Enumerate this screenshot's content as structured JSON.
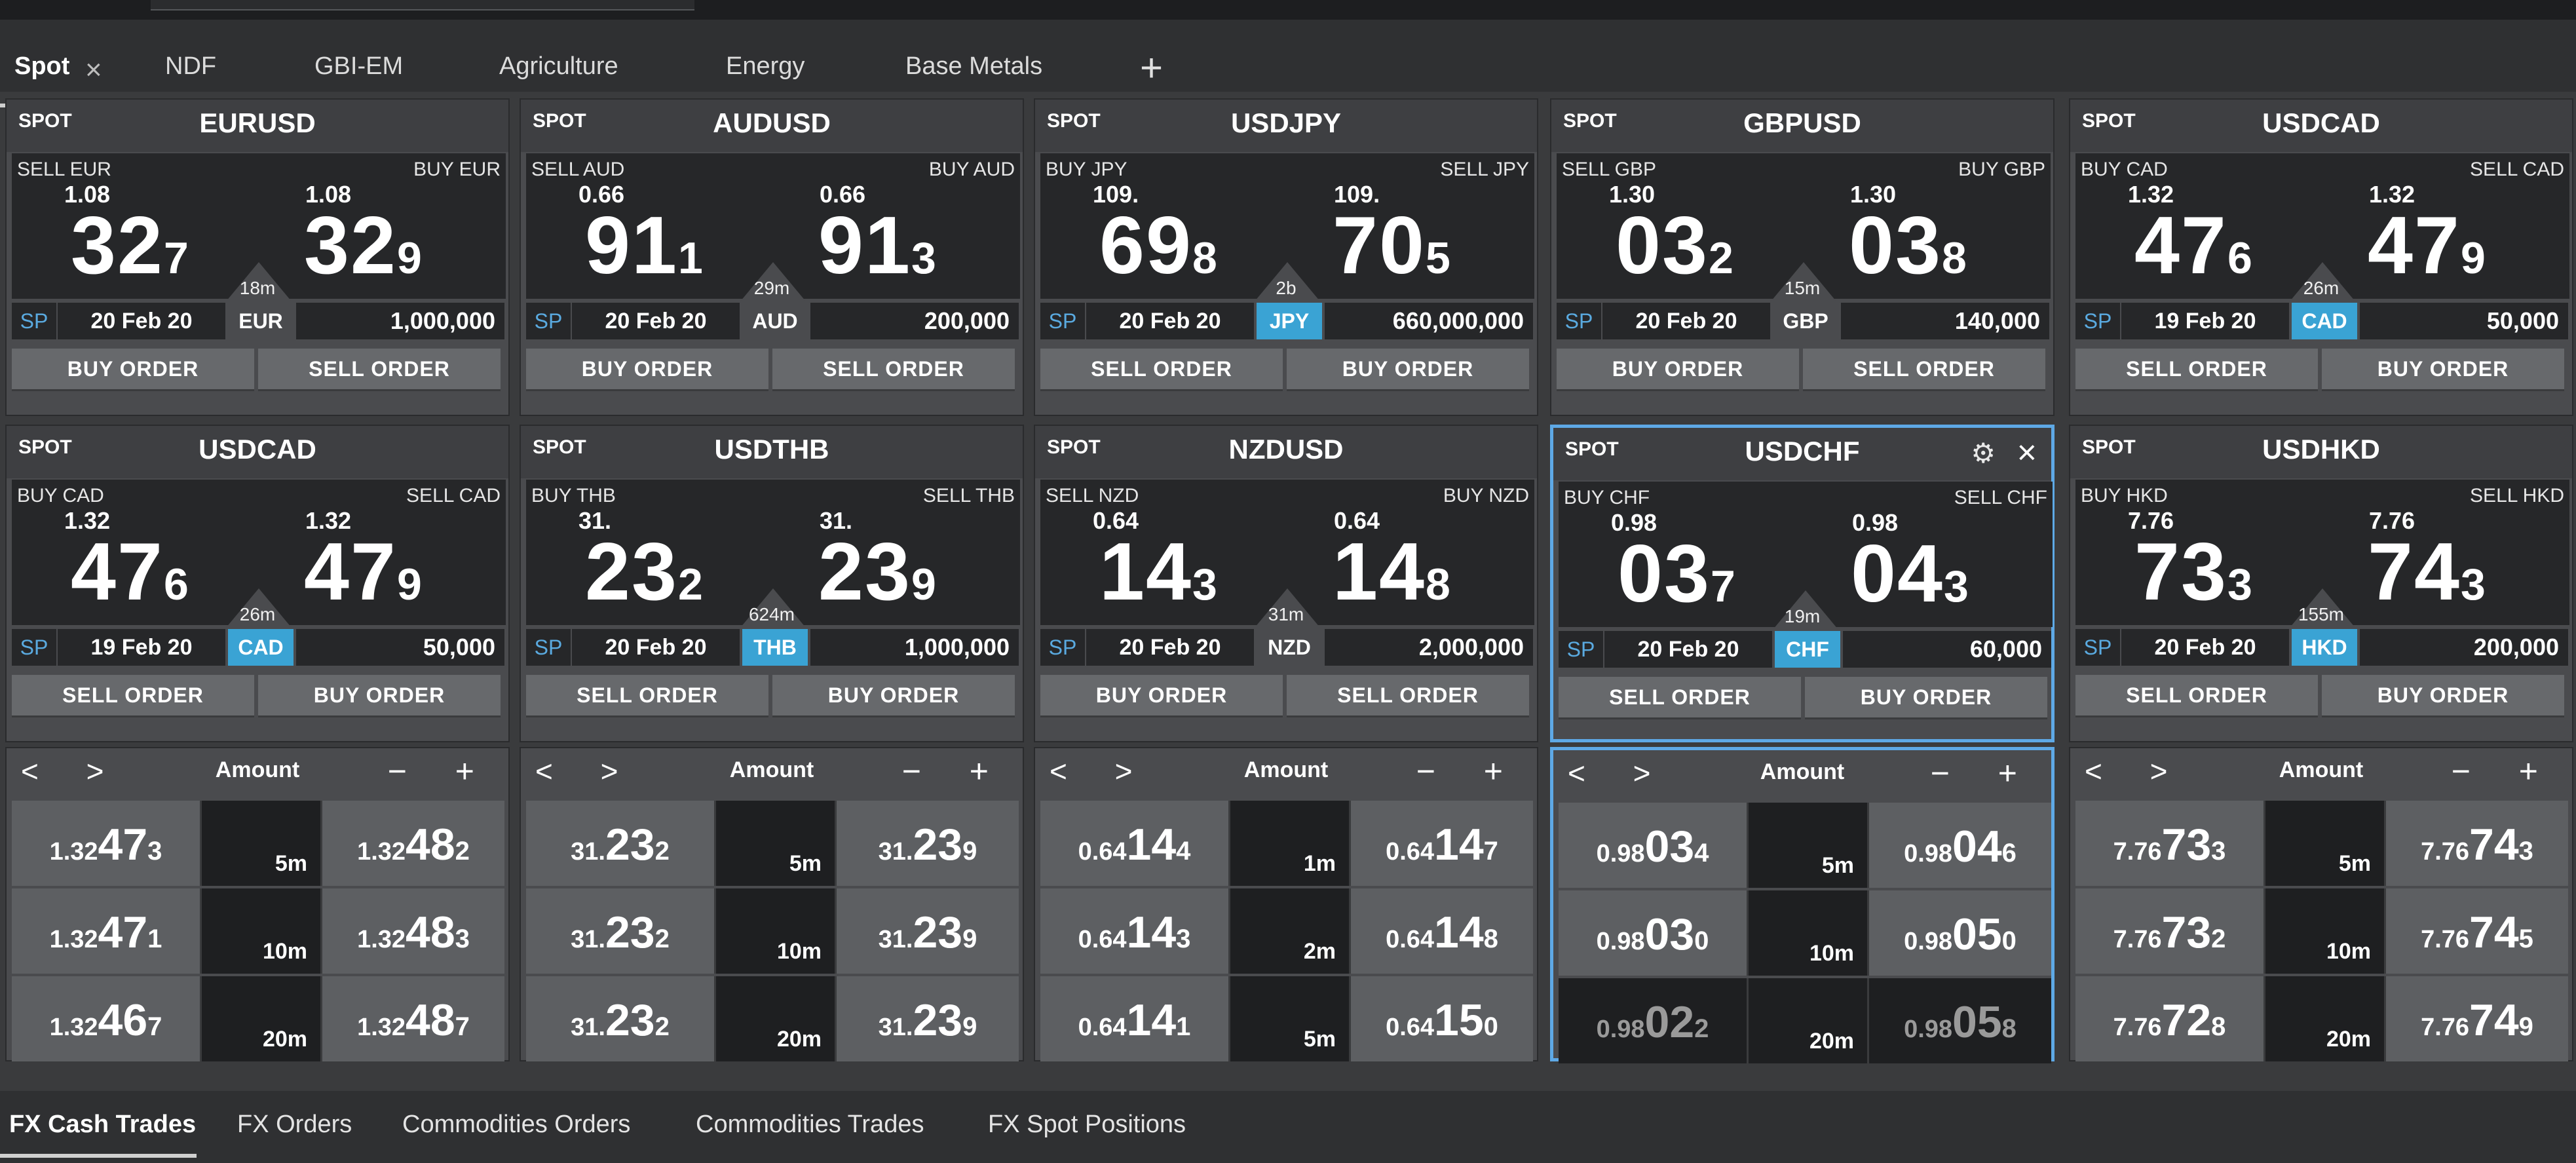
{
  "tabs": {
    "items": [
      "Spot",
      "NDF",
      "GBI-EM",
      "Agriculture",
      "Energy",
      "Base Metals"
    ],
    "close_glyph": "×",
    "add_glyph": "+"
  },
  "tiles": [
    {
      "spot": "SPOT",
      "pair": "EURUSD",
      "left_label": "SELL EUR",
      "left_big": "1.08",
      "left_pips": "32",
      "left_small": "7",
      "right_label": "BUY EUR",
      "right_big": "1.08",
      "right_pips": "32",
      "right_small": "9",
      "spread": "18m",
      "sp": "SP",
      "date": "20 Feb 20",
      "ccy": "EUR",
      "ccy_active": false,
      "amount": "1,000,000",
      "btn_left": "BUY ORDER",
      "btn_right": "SELL ORDER"
    },
    {
      "spot": "SPOT",
      "pair": "AUDUSD",
      "left_label": "SELL AUD",
      "left_big": "0.66",
      "left_pips": "91",
      "left_small": "1",
      "right_label": "BUY AUD",
      "right_big": "0.66",
      "right_pips": "91",
      "right_small": "3",
      "spread": "29m",
      "sp": "SP",
      "date": "20 Feb 20",
      "ccy": "AUD",
      "ccy_active": false,
      "amount": "200,000",
      "btn_left": "BUY ORDER",
      "btn_right": "SELL ORDER"
    },
    {
      "spot": "SPOT",
      "pair": "USDJPY",
      "left_label": "BUY JPY",
      "left_big": "109.",
      "left_pips": "69",
      "left_small": "8",
      "right_label": "SELL JPY",
      "right_big": "109.",
      "right_pips": "70",
      "right_small": "5",
      "spread": "2b",
      "sp": "SP",
      "date": "20 Feb 20",
      "ccy": "JPY",
      "ccy_active": true,
      "amount": "660,000,000",
      "btn_left": "SELL ORDER",
      "btn_right": "BUY ORDER"
    },
    {
      "spot": "SPOT",
      "pair": "GBPUSD",
      "left_label": "SELL GBP",
      "left_big": "1.30",
      "left_pips": "03",
      "left_small": "2",
      "right_label": "BUY GBP",
      "right_big": "1.30",
      "right_pips": "03",
      "right_small": "8",
      "spread": "15m",
      "sp": "SP",
      "date": "20 Feb 20",
      "ccy": "GBP",
      "ccy_active": false,
      "amount": "140,000",
      "btn_left": "BUY ORDER",
      "btn_right": "SELL ORDER"
    },
    {
      "spot": "SPOT",
      "pair": "USDCAD",
      "left_label": "BUY CAD",
      "left_big": "1.32",
      "left_pips": "47",
      "left_small": "6",
      "right_label": "SELL CAD",
      "right_big": "1.32",
      "right_pips": "47",
      "right_small": "9",
      "spread": "26m",
      "sp": "SP",
      "date": "19 Feb 20",
      "ccy": "CAD",
      "ccy_active": true,
      "amount": "50,000",
      "btn_left": "SELL ORDER",
      "btn_right": "BUY ORDER"
    },
    {
      "spot": "SPOT",
      "pair": "USDCAD",
      "left_label": "BUY CAD",
      "left_big": "1.32",
      "left_pips": "47",
      "left_small": "6",
      "right_label": "SELL CAD",
      "right_big": "1.32",
      "right_pips": "47",
      "right_small": "9",
      "spread": "26m",
      "sp": "SP",
      "date": "19 Feb 20",
      "ccy": "CAD",
      "ccy_active": true,
      "amount": "50,000",
      "btn_left": "SELL ORDER",
      "btn_right": "BUY ORDER"
    },
    {
      "spot": "SPOT",
      "pair": "USDTHB",
      "left_label": "BUY THB",
      "left_big": "31.",
      "left_pips": "23",
      "left_small": "2",
      "right_label": "SELL THB",
      "right_big": "31.",
      "right_pips": "23",
      "right_small": "9",
      "spread": "624m",
      "sp": "SP",
      "date": "20 Feb 20",
      "ccy": "THB",
      "ccy_active": true,
      "amount": "1,000,000",
      "btn_left": "SELL ORDER",
      "btn_right": "BUY ORDER"
    },
    {
      "spot": "SPOT",
      "pair": "NZDUSD",
      "left_label": "SELL NZD",
      "left_big": "0.64",
      "left_pips": "14",
      "left_small": "3",
      "right_label": "BUY NZD",
      "right_big": "0.64",
      "right_pips": "14",
      "right_small": "8",
      "spread": "31m",
      "sp": "SP",
      "date": "20 Feb 20",
      "ccy": "NZD",
      "ccy_active": false,
      "amount": "2,000,000",
      "btn_left": "BUY ORDER",
      "btn_right": "SELL ORDER"
    },
    {
      "spot": "SPOT",
      "pair": "USDCHF",
      "left_label": "BUY CHF",
      "left_big": "0.98",
      "left_pips": "03",
      "left_small": "7",
      "right_label": "SELL CHF",
      "right_big": "0.98",
      "right_pips": "04",
      "right_small": "3",
      "spread": "19m",
      "sp": "SP",
      "date": "20 Feb 20",
      "ccy": "CHF",
      "ccy_active": true,
      "amount": "60,000",
      "btn_left": "SELL ORDER",
      "btn_right": "BUY ORDER",
      "highlight": true
    },
    {
      "spot": "SPOT",
      "pair": "USDHKD",
      "left_label": "BUY HKD",
      "left_big": "7.76",
      "left_pips": "73",
      "left_small": "3",
      "right_label": "SELL HKD",
      "right_big": "7.76",
      "right_pips": "74",
      "right_small": "3",
      "spread": "155m",
      "sp": "SP",
      "date": "20 Feb 20",
      "ccy": "HKD",
      "ccy_active": true,
      "amount": "200,000",
      "btn_left": "SELL ORDER",
      "btn_right": "BUY ORDER"
    }
  ],
  "ladders": [
    {
      "title": "Amount",
      "nav": "< >",
      "pm": "− +",
      "rows": [
        {
          "bid_pre": "1.32",
          "bid_hi": "47",
          "bid_lo": "3",
          "mid": "5m",
          "ask_pre": "1.32",
          "ask_hi": "48",
          "ask_lo": "2"
        },
        {
          "bid_pre": "1.32",
          "bid_hi": "47",
          "bid_lo": "1",
          "mid": "10m",
          "ask_pre": "1.32",
          "ask_hi": "48",
          "ask_lo": "3"
        },
        {
          "bid_pre": "1.32",
          "bid_hi": "46",
          "bid_lo": "7",
          "mid": "20m",
          "ask_pre": "1.32",
          "ask_hi": "48",
          "ask_lo": "7"
        }
      ]
    },
    {
      "title": "Amount",
      "nav": "< >",
      "pm": "− +",
      "rows": [
        {
          "bid_pre": "31.",
          "bid_hi": "23",
          "bid_lo": "2",
          "mid": "5m",
          "ask_pre": "31.",
          "ask_hi": "23",
          "ask_lo": "9"
        },
        {
          "bid_pre": "31.",
          "bid_hi": "23",
          "bid_lo": "2",
          "mid": "10m",
          "ask_pre": "31.",
          "ask_hi": "23",
          "ask_lo": "9"
        },
        {
          "bid_pre": "31.",
          "bid_hi": "23",
          "bid_lo": "2",
          "mid": "20m",
          "ask_pre": "31.",
          "ask_hi": "23",
          "ask_lo": "9"
        }
      ]
    },
    {
      "title": "Amount",
      "nav": "< >",
      "pm": "− +",
      "rows": [
        {
          "bid_pre": "0.64",
          "bid_hi": "14",
          "bid_lo": "4",
          "mid": "1m",
          "ask_pre": "0.64",
          "ask_hi": "14",
          "ask_lo": "7"
        },
        {
          "bid_pre": "0.64",
          "bid_hi": "14",
          "bid_lo": "3",
          "mid": "2m",
          "ask_pre": "0.64",
          "ask_hi": "14",
          "ask_lo": "8"
        },
        {
          "bid_pre": "0.64",
          "bid_hi": "14",
          "bid_lo": "1",
          "mid": "5m",
          "ask_pre": "0.64",
          "ask_hi": "15",
          "ask_lo": "0"
        }
      ]
    },
    {
      "title": "Amount",
      "nav": "< >",
      "pm": "− +",
      "rows": [
        {
          "bid_pre": "0.98",
          "bid_hi": "03",
          "bid_lo": "4",
          "mid": "5m",
          "ask_pre": "0.98",
          "ask_hi": "04",
          "ask_lo": "6"
        },
        {
          "bid_pre": "0.98",
          "bid_hi": "03",
          "bid_lo": "0",
          "mid": "10m",
          "ask_pre": "0.98",
          "ask_hi": "05",
          "ask_lo": "0"
        },
        {
          "bid_pre": "0.98",
          "bid_hi": "02",
          "bid_lo": "2",
          "mid": "20m",
          "ask_pre": "0.98",
          "ask_hi": "05",
          "ask_lo": "8",
          "dim": true
        }
      ]
    },
    {
      "title": "Amount",
      "nav": "< >",
      "pm": "− +",
      "rows": [
        {
          "bid_pre": "7.76",
          "bid_hi": "73",
          "bid_lo": "3",
          "mid": "5m",
          "ask_pre": "7.76",
          "ask_hi": "74",
          "ask_lo": "3"
        },
        {
          "bid_pre": "7.76",
          "bid_hi": "73",
          "bid_lo": "2",
          "mid": "10m",
          "ask_pre": "7.76",
          "ask_hi": "74",
          "ask_lo": "5"
        },
        {
          "bid_pre": "7.76",
          "bid_hi": "72",
          "bid_lo": "8",
          "mid": "20m",
          "ask_pre": "7.76",
          "ask_hi": "74",
          "ask_lo": "9"
        }
      ]
    }
  ],
  "bottom_tabs": [
    "FX Cash Trades",
    "FX Orders",
    "Commodities Orders",
    "Commodities Trades",
    "FX Spot Positions"
  ],
  "more_glyph": "...",
  "colors": {
    "accent": "#3aa3d4",
    "highlight": "#5ea9e6",
    "sp_text": "#5aaae0"
  }
}
